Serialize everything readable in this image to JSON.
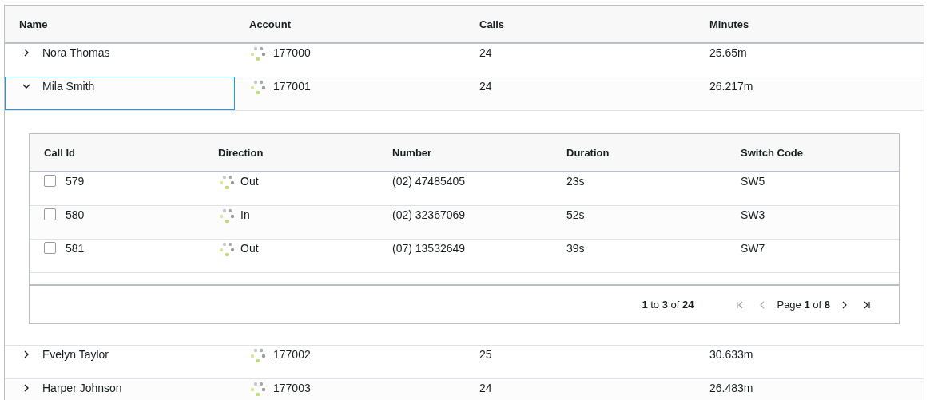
{
  "columns": [
    "Name",
    "Account",
    "Calls",
    "Minutes"
  ],
  "rows": [
    {
      "name": "Nora Thomas",
      "account": "177000",
      "calls": "24",
      "minutes": "25.65m",
      "expanded": false,
      "selected": false
    },
    {
      "name": "Mila Smith",
      "account": "177001",
      "calls": "24",
      "minutes": "26.217m",
      "expanded": true,
      "selected": true,
      "detail": {
        "columns": [
          "Call Id",
          "Direction",
          "Number",
          "Duration",
          "Switch Code"
        ],
        "rows": [
          {
            "call_id": "579",
            "direction": "Out",
            "number": "(02) 47485405",
            "duration": "23s",
            "switch_code": "SW5",
            "checked": false
          },
          {
            "call_id": "580",
            "direction": "In",
            "number": "(02) 32367069",
            "duration": "52s",
            "switch_code": "SW3",
            "checked": false
          },
          {
            "call_id": "581",
            "direction": "Out",
            "number": "(07) 13532649",
            "duration": "39s",
            "switch_code": "SW7",
            "checked": false
          }
        ],
        "paging": {
          "summary": "**1** to **3** of **24**",
          "page": "Page **1** of **8**"
        }
      }
    },
    {
      "name": "Evelyn Taylor",
      "account": "177002",
      "calls": "25",
      "minutes": "30.633m",
      "expanded": false,
      "selected": false
    },
    {
      "name": "Harper Johnson",
      "account": "177003",
      "calls": "24",
      "minutes": "26.483m",
      "expanded": false,
      "selected": false
    }
  ]
}
